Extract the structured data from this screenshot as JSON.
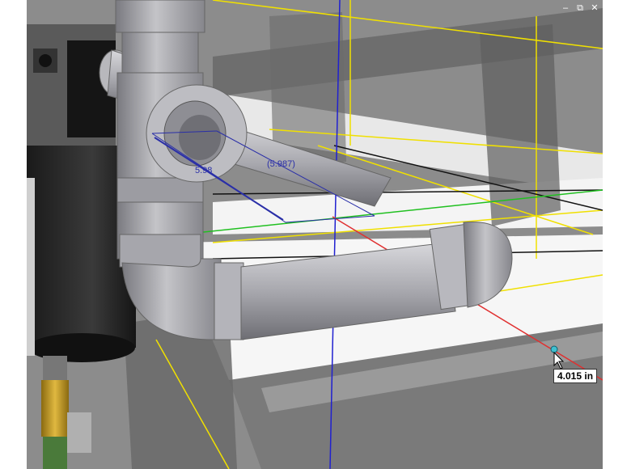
{
  "window_controls": {
    "minimize": "–",
    "restore": "⧉",
    "close": "✕"
  },
  "dimensions": {
    "dim_a": "5.98",
    "dim_b": "(5.987)"
  },
  "measurement_readout": "4.015 in",
  "colors": {
    "x_axis": "#e03030",
    "y_axis": "#2020d0",
    "z_axis": "#20c020",
    "guide": "#f0e000",
    "dimension": "#2a2fa8",
    "background": "#ffffff"
  },
  "icons": {
    "cursor": "arrow-cursor-icon",
    "snap_point": "snap-point-icon"
  }
}
